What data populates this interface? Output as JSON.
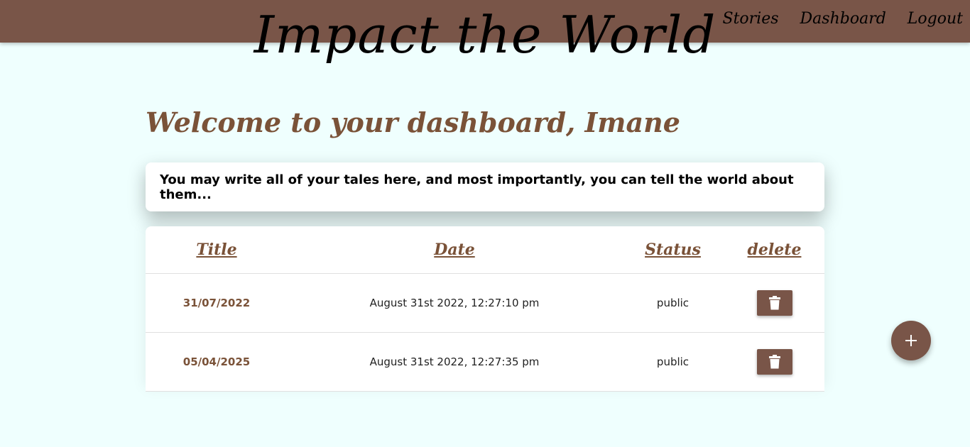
{
  "nav": {
    "brand": "Impact the World",
    "links": [
      "Stories",
      "Dashboard",
      "Logout"
    ]
  },
  "welcome": "Welcome to your dashboard, Imane",
  "intro": "You may write all of your tales here, and most importantly, you can tell the world about them...",
  "table": {
    "headers": [
      "Title",
      "Date",
      "Status",
      "delete"
    ],
    "rows": [
      {
        "title": "31/07/2022",
        "date": "August 31st 2022, 12:27:10 pm",
        "status": "public"
      },
      {
        "title": "05/04/2025",
        "date": "August 31st 2022, 12:27:35 pm",
        "status": "public"
      }
    ]
  },
  "icons": {
    "delete": "trash-icon",
    "add": "plus-icon"
  },
  "colors": {
    "brand_brown": "#795548",
    "accent_text": "#7a5238",
    "page_background": "#effffe"
  }
}
